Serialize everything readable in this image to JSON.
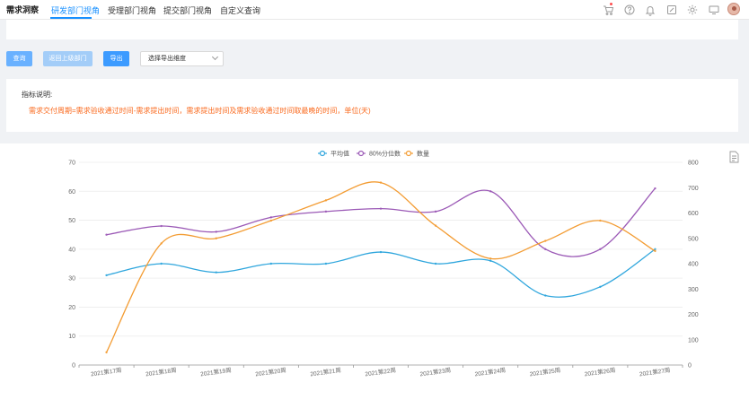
{
  "header": {
    "brand": "需求洞察",
    "tabs": [
      {
        "label": "研发部门视角",
        "active": true
      },
      {
        "label": "受理部门视角",
        "active": false
      },
      {
        "label": "提交部门视角",
        "active": false
      },
      {
        "label": "自定义查询",
        "active": false
      }
    ],
    "icons": [
      "cart-icon",
      "help-icon",
      "bell-icon",
      "note-icon",
      "gear-icon",
      "monitor-icon",
      "avatar"
    ]
  },
  "toolbar": {
    "query_label": "查询",
    "back_label": "返回上级部门",
    "export_label": "导出",
    "select_placeholder": "选择导出维度"
  },
  "description": {
    "title": "指标说明:",
    "text": "需求交付周期=需求验收通过时间-需求提出时间，需求提出时间及需求验收通过时间取最晚的时间，单位(天)"
  },
  "colors": {
    "accent": "#1890ff",
    "avg": "#2fa6dd",
    "p80": "#9b59b6",
    "count": "#f39c33",
    "desc_text": "#fa6a1e"
  },
  "chart_data": {
    "type": "line",
    "categories": [
      "2021第17周",
      "2021第18周",
      "2021第19周",
      "2021第20周",
      "2021第21周",
      "2021第22周",
      "2021第23周",
      "2021第24周",
      "2021第25周",
      "2021第26周",
      "2021第27周"
    ],
    "y_left": {
      "min": 0,
      "max": 70,
      "ticks": [
        0,
        10,
        20,
        30,
        40,
        50,
        60,
        70
      ]
    },
    "y_right": {
      "min": 0,
      "max": 800,
      "ticks": [
        0,
        100,
        200,
        300,
        400,
        500,
        600,
        700,
        800
      ]
    },
    "series": [
      {
        "name": "平均值",
        "axis": "left",
        "color": "#2fa6dd",
        "values": [
          31,
          35,
          32,
          35,
          35,
          39,
          35,
          36,
          24,
          27,
          40
        ]
      },
      {
        "name": "80%分位数",
        "axis": "left",
        "color": "#9b59b6",
        "values": [
          45,
          48,
          46,
          51,
          53,
          54,
          53,
          60,
          40,
          40,
          61
        ]
      },
      {
        "name": "数量",
        "axis": "right",
        "color": "#f39c33",
        "values": [
          50,
          480,
          500,
          570,
          650,
          720,
          550,
          420,
          490,
          570,
          450
        ]
      }
    ],
    "grid": true,
    "legend_position": "top-center"
  }
}
